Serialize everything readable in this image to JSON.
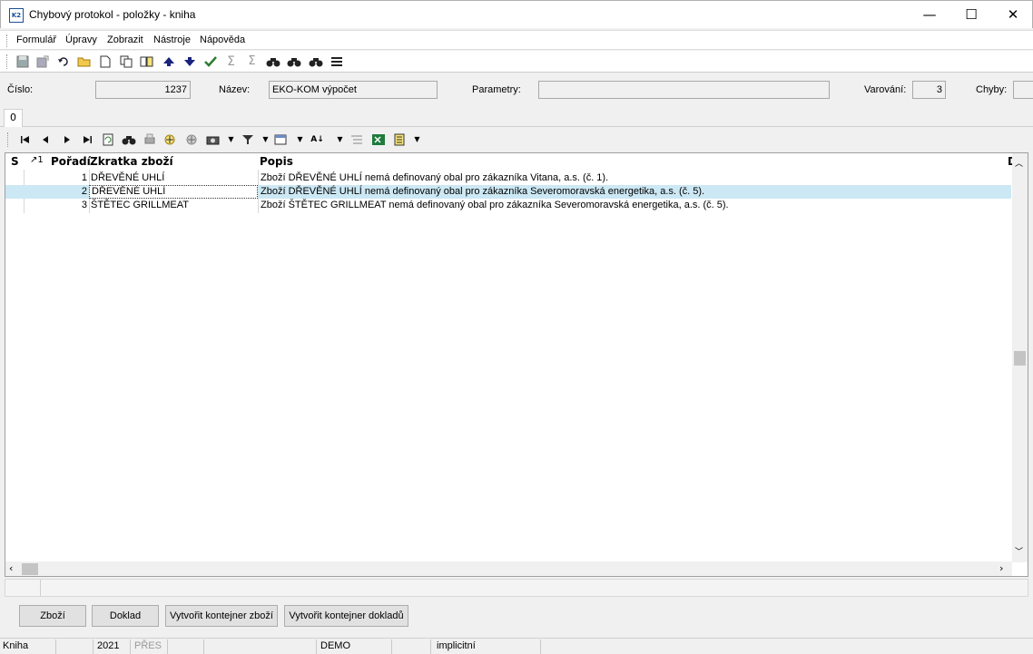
{
  "window": {
    "title": "Chybový protokol - položky - kniha",
    "app_icon": "K2",
    "minimize_glyph": "—",
    "maximize_glyph": "☐",
    "close_glyph": "✕"
  },
  "menu": [
    "Formulář",
    "Úpravy",
    "Zobrazit",
    "Nástroje",
    "Nápověda"
  ],
  "toolbar_icons": [
    "save-icon",
    "save-as-icon",
    "undo-icon",
    "open-folder-icon",
    "new-document-icon",
    "copy-icon",
    "book-icon",
    "arrow-up-icon",
    "arrow-down-icon",
    "check-icon",
    "sum-icon",
    "sum-filtered-icon",
    "binoculars-icon",
    "binoculars-next-icon",
    "binoculars-replace-icon",
    "list-icon"
  ],
  "header": {
    "cislo_label": "Číslo:",
    "cislo_value": "1237",
    "nazev_label": "Název:",
    "nazev_value": "EKO-KOM výpočet",
    "parametry_label": "Parametry:",
    "parametry_value": "",
    "varovani_label": "Varování:",
    "varovani_value": "3",
    "chyby_label": "Chyby:",
    "chyby_value": ""
  },
  "tabs": [
    "0"
  ],
  "grid": {
    "columns": [
      "S",
      "↗1",
      "Pořadí",
      "Zkratka zboží",
      "Popis",
      "D"
    ],
    "rows": [
      {
        "poradi": "1",
        "zkratka": "DŘEVĚNÉ UHLÍ",
        "popis": "Zboží DŘEVĚNÉ UHLÍ nemá definovaný obal pro zákazníka Vitana, a.s. (č. 1)."
      },
      {
        "poradi": "2",
        "zkratka": "DŘEVĚNÉ UHLÍ",
        "popis": "Zboží DŘEVĚNÉ UHLÍ nemá definovaný obal pro zákazníka Severomoravská energetika, a.s. (č. 5)."
      },
      {
        "poradi": "3",
        "zkratka": "ŠTĚTEC GRILLMEAT",
        "popis": "Zboží ŠTĚTEC GRILLMEAT nemá definovaný obal pro zákazníka Severomoravská energetika, a.s. (č. 5)."
      }
    ],
    "selected_row": 2
  },
  "buttons": [
    "Zboží",
    "Doklad",
    "Vytvořit kontejner zboží",
    "Vytvořit kontejner dokladů"
  ],
  "statusbar": [
    "Kniha",
    "2021",
    "PŘES",
    "DEMO",
    "implicitní"
  ],
  "colors": {
    "selected_row": "#cce8f4",
    "titlebar": "#ffffff",
    "window_bg": "#f0f0f0"
  }
}
